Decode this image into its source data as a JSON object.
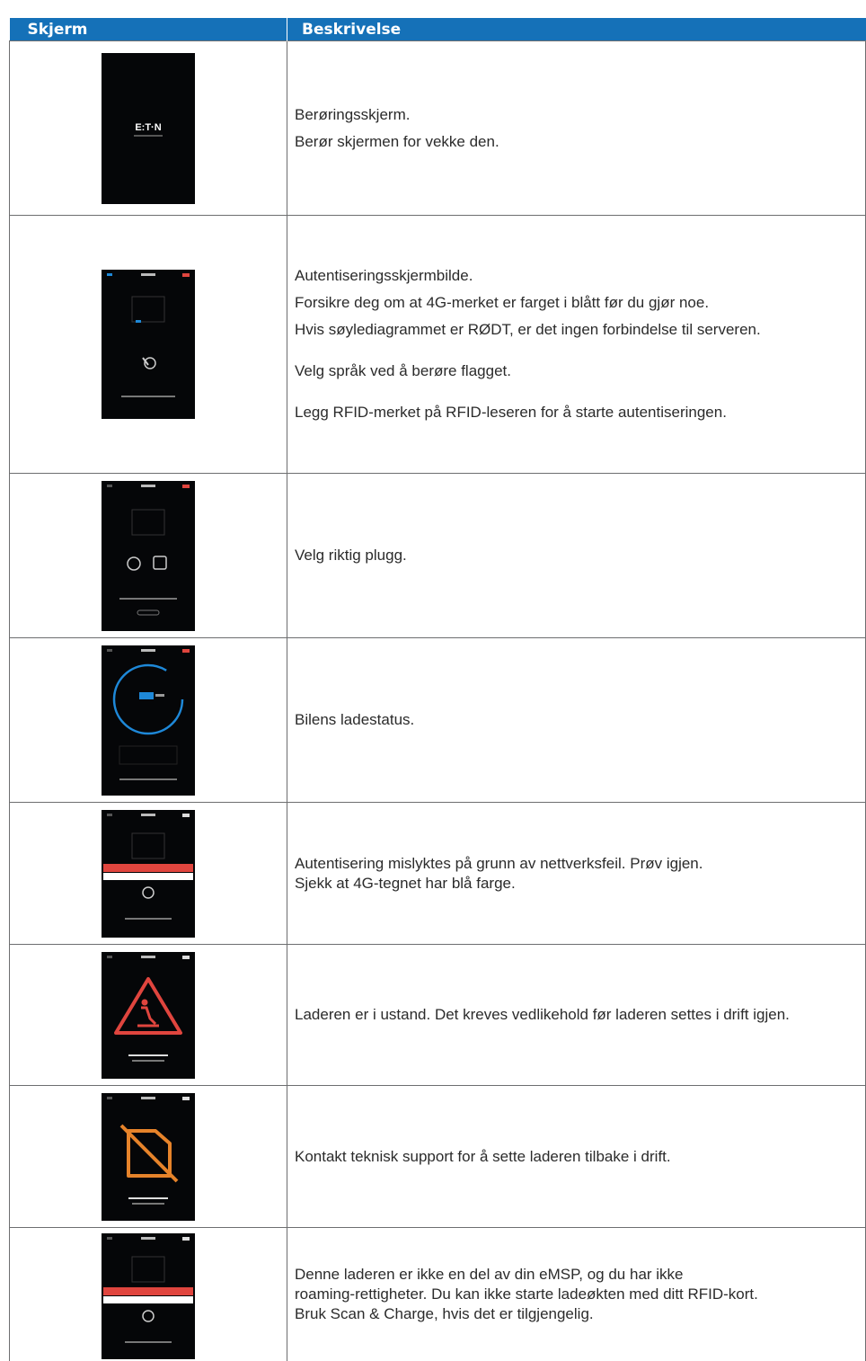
{
  "table": {
    "headers": {
      "screen": "Skjerm",
      "description": "Beskrivelse"
    },
    "rows": [
      {
        "icon": "eaton-logo-screen",
        "logo_text": "E:T·N",
        "lines": [
          "Berøringsskjerm.",
          "Berør skjermen for vekke den."
        ]
      },
      {
        "icon": "authentication-screen",
        "lines": [
          "Autentiseringsskjermbilde.",
          "Forsikre deg om at 4G-merket er farget i blått før du gjør noe.",
          "Hvis søylediagrammet er RØDT, er det ingen forbindelse til serveren.",
          "Velg språk ved å berøre flagget.",
          "Legg RFID-merket på RFID-leseren for å starte autentiseringen."
        ]
      },
      {
        "icon": "plug-selection-screen",
        "lines": [
          "Velg riktig plugg."
        ]
      },
      {
        "icon": "charging-status-screen",
        "lines": [
          "Bilens ladestatus."
        ]
      },
      {
        "icon": "network-error-screen",
        "lines": [
          "Autentisering mislyktes på grunn av nettverksfeil. Prøv igjen.",
          "Sjekk at 4G-tegnet har blå farge."
        ]
      },
      {
        "icon": "maintenance-warning-screen",
        "lines": [
          "Laderen er i ustand. Det kreves vedlikehold før laderen settes i drift igjen."
        ]
      },
      {
        "icon": "out-of-order-screen",
        "lines": [
          "Kontakt teknisk support for å sette laderen tilbake i drift."
        ]
      },
      {
        "icon": "roaming-denied-screen",
        "lines": [
          "Denne laderen er ikke en del av din eMSP, og du har ikke",
          "roaming-rettigheter. Du kan ikke starte ladeøkten med ditt RFID-kort.",
          "Bruk Scan & Charge, hvis det er tilgjengelig."
        ]
      }
    ]
  },
  "colors": {
    "header_bg": "#1571b8",
    "screen_bg": "#050608",
    "accent_blue": "#1e88d8",
    "alert_red": "#e0453e",
    "warning_orange": "#e6832a"
  }
}
